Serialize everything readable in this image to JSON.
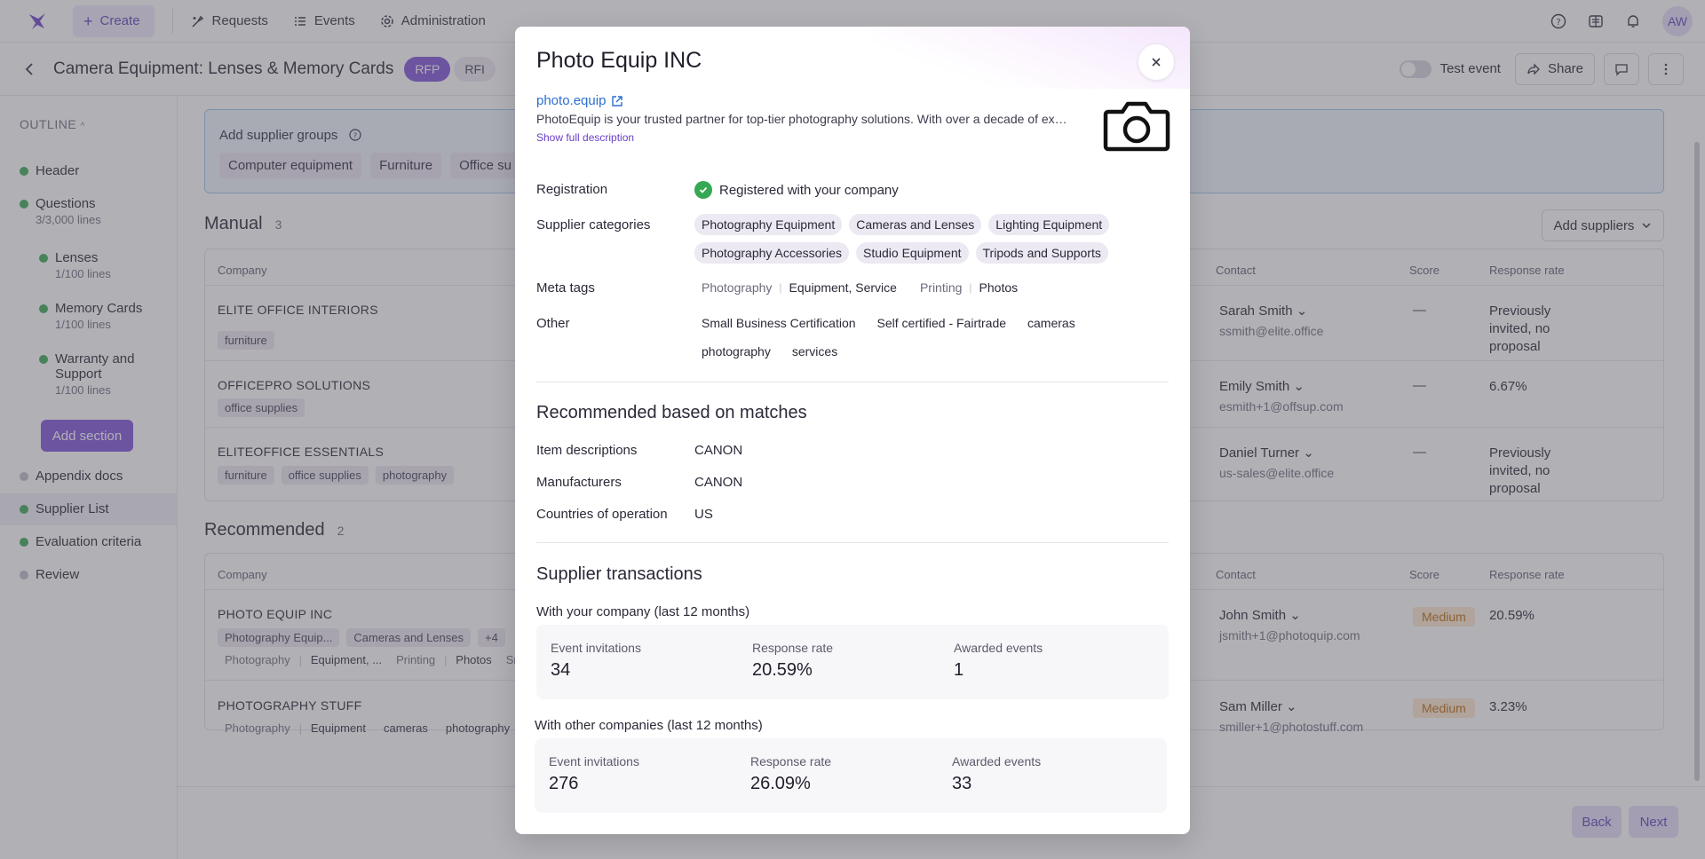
{
  "nav": {
    "create": "Create",
    "items": [
      {
        "label": "Requests",
        "icon": "requests-icon"
      },
      {
        "label": "Events",
        "icon": "list-icon"
      },
      {
        "label": "Administration",
        "icon": "gear-icon"
      }
    ],
    "avatar": "AW"
  },
  "header": {
    "title": "Camera Equipment: Lenses & Memory Cards",
    "rfp": "RFP",
    "rfi": "RFI",
    "test_event": "Test event",
    "share": "Share"
  },
  "sidebar": {
    "outline": "OUTLINE",
    "items": [
      {
        "label": "Header",
        "sub": "",
        "status": "done"
      },
      {
        "label": "Questions",
        "sub": "3/3,000 lines",
        "status": "done"
      },
      {
        "label": "Lenses",
        "sub": "1/100 lines",
        "status": "done"
      },
      {
        "label": "Memory Cards",
        "sub": "1/100 lines",
        "status": "done"
      },
      {
        "label": "Warranty and Support",
        "sub": "1/100 lines",
        "status": "done"
      },
      {
        "label": "Appendix docs",
        "sub": "",
        "status": "pending"
      },
      {
        "label": "Supplier List",
        "sub": "",
        "status": "done"
      },
      {
        "label": "Evaluation criteria",
        "sub": "",
        "status": "done"
      },
      {
        "label": "Review",
        "sub": "",
        "status": "pending"
      }
    ],
    "add_section": "Add section"
  },
  "main": {
    "groups_label": "Add supplier groups",
    "groups": [
      "Computer equipment",
      "Furniture",
      "Office su"
    ],
    "manual": {
      "title": "Manual",
      "count": "3",
      "columns": {
        "company": "Company",
        "contact": "Contact",
        "score": "Score",
        "response": "Response rate"
      },
      "add_suppliers": "Add suppliers",
      "rows": [
        {
          "company": "ELITE OFFICE INTERIORS",
          "tags": [
            "furniture"
          ],
          "contact": "Sarah Smith",
          "email": "ssmith@elite.office",
          "score": "—",
          "response": "Previously invited, no proposal"
        },
        {
          "company": "OFFICEPRO SOLUTIONS",
          "tags": [
            "office supplies"
          ],
          "contact": "Emily Smith",
          "email": "esmith+1@offsup.com",
          "score": "—",
          "response": "6.67%"
        },
        {
          "company": "ELITEOFFICE ESSENTIALS",
          "tags": [
            "furniture",
            "office supplies",
            "photography"
          ],
          "contact": "Daniel Turner",
          "email": "us-sales@elite.office",
          "score": "—",
          "response": "Previously invited, no proposal"
        }
      ]
    },
    "recommended": {
      "title": "Recommended",
      "count": "2",
      "rows": [
        {
          "company": "PHOTO EQUIP INC",
          "chips": [
            "Photography Equip...",
            "Cameras and Lenses",
            "+4"
          ],
          "meta": [
            "Photography",
            "Equipment, ...",
            "Printing",
            "Photos",
            "Sr"
          ],
          "contact": "John Smith",
          "email": "jsmith+1@photoquip.com",
          "score": "Medium",
          "response": "20.59%"
        },
        {
          "company": "PHOTOGRAPHY STUFF",
          "meta": [
            "Photography",
            "Equipment",
            "cameras",
            "photography"
          ],
          "contact": "Sam Miller",
          "email": "smiller+1@photostuff.com",
          "score": "Medium",
          "response": "3.23%"
        }
      ]
    },
    "back": "Back",
    "next": "Next"
  },
  "modal": {
    "title": "Photo Equip INC",
    "website": "photo.equip",
    "description": "PhotoEquip is your trusted partner for top-tier photography solutions. With over a decade of experience",
    "show_full": "Show full description",
    "labels": {
      "registration": "Registration",
      "categories": "Supplier categories",
      "meta": "Meta tags",
      "other": "Other"
    },
    "registration": "Registered with your company",
    "categories": [
      "Photography Equipment",
      "Cameras and Lenses",
      "Lighting Equipment",
      "Photography Accessories",
      "Studio Equipment",
      "Tripods and Supports"
    ],
    "meta_tags": [
      {
        "key": "Photography",
        "value": "Equipment, Service"
      },
      {
        "key": "Printing",
        "value": "Photos"
      }
    ],
    "other": [
      "Small Business Certification",
      "Self certified - Fairtrade",
      "cameras",
      "photography",
      "services"
    ],
    "recommended": {
      "title": "Recommended based on matches",
      "rows": [
        {
          "label": "Item descriptions",
          "value": "CANON"
        },
        {
          "label": "Manufacturers",
          "value": "CANON"
        },
        {
          "label": "Countries of operation",
          "value": "US"
        }
      ]
    },
    "transactions": {
      "title": "Supplier transactions",
      "yours": {
        "label": "With your company (last 12 months)",
        "stats": [
          {
            "label": "Event invitations",
            "value": "34"
          },
          {
            "label": "Response rate",
            "value": "20.59%"
          },
          {
            "label": "Awarded events",
            "value": "1"
          }
        ]
      },
      "others": {
        "label": "With other companies (last 12 months)",
        "stats": [
          {
            "label": "Event invitations",
            "value": "276"
          },
          {
            "label": "Response rate",
            "value": "26.09%"
          },
          {
            "label": "Awarded events",
            "value": "33"
          }
        ]
      }
    }
  }
}
